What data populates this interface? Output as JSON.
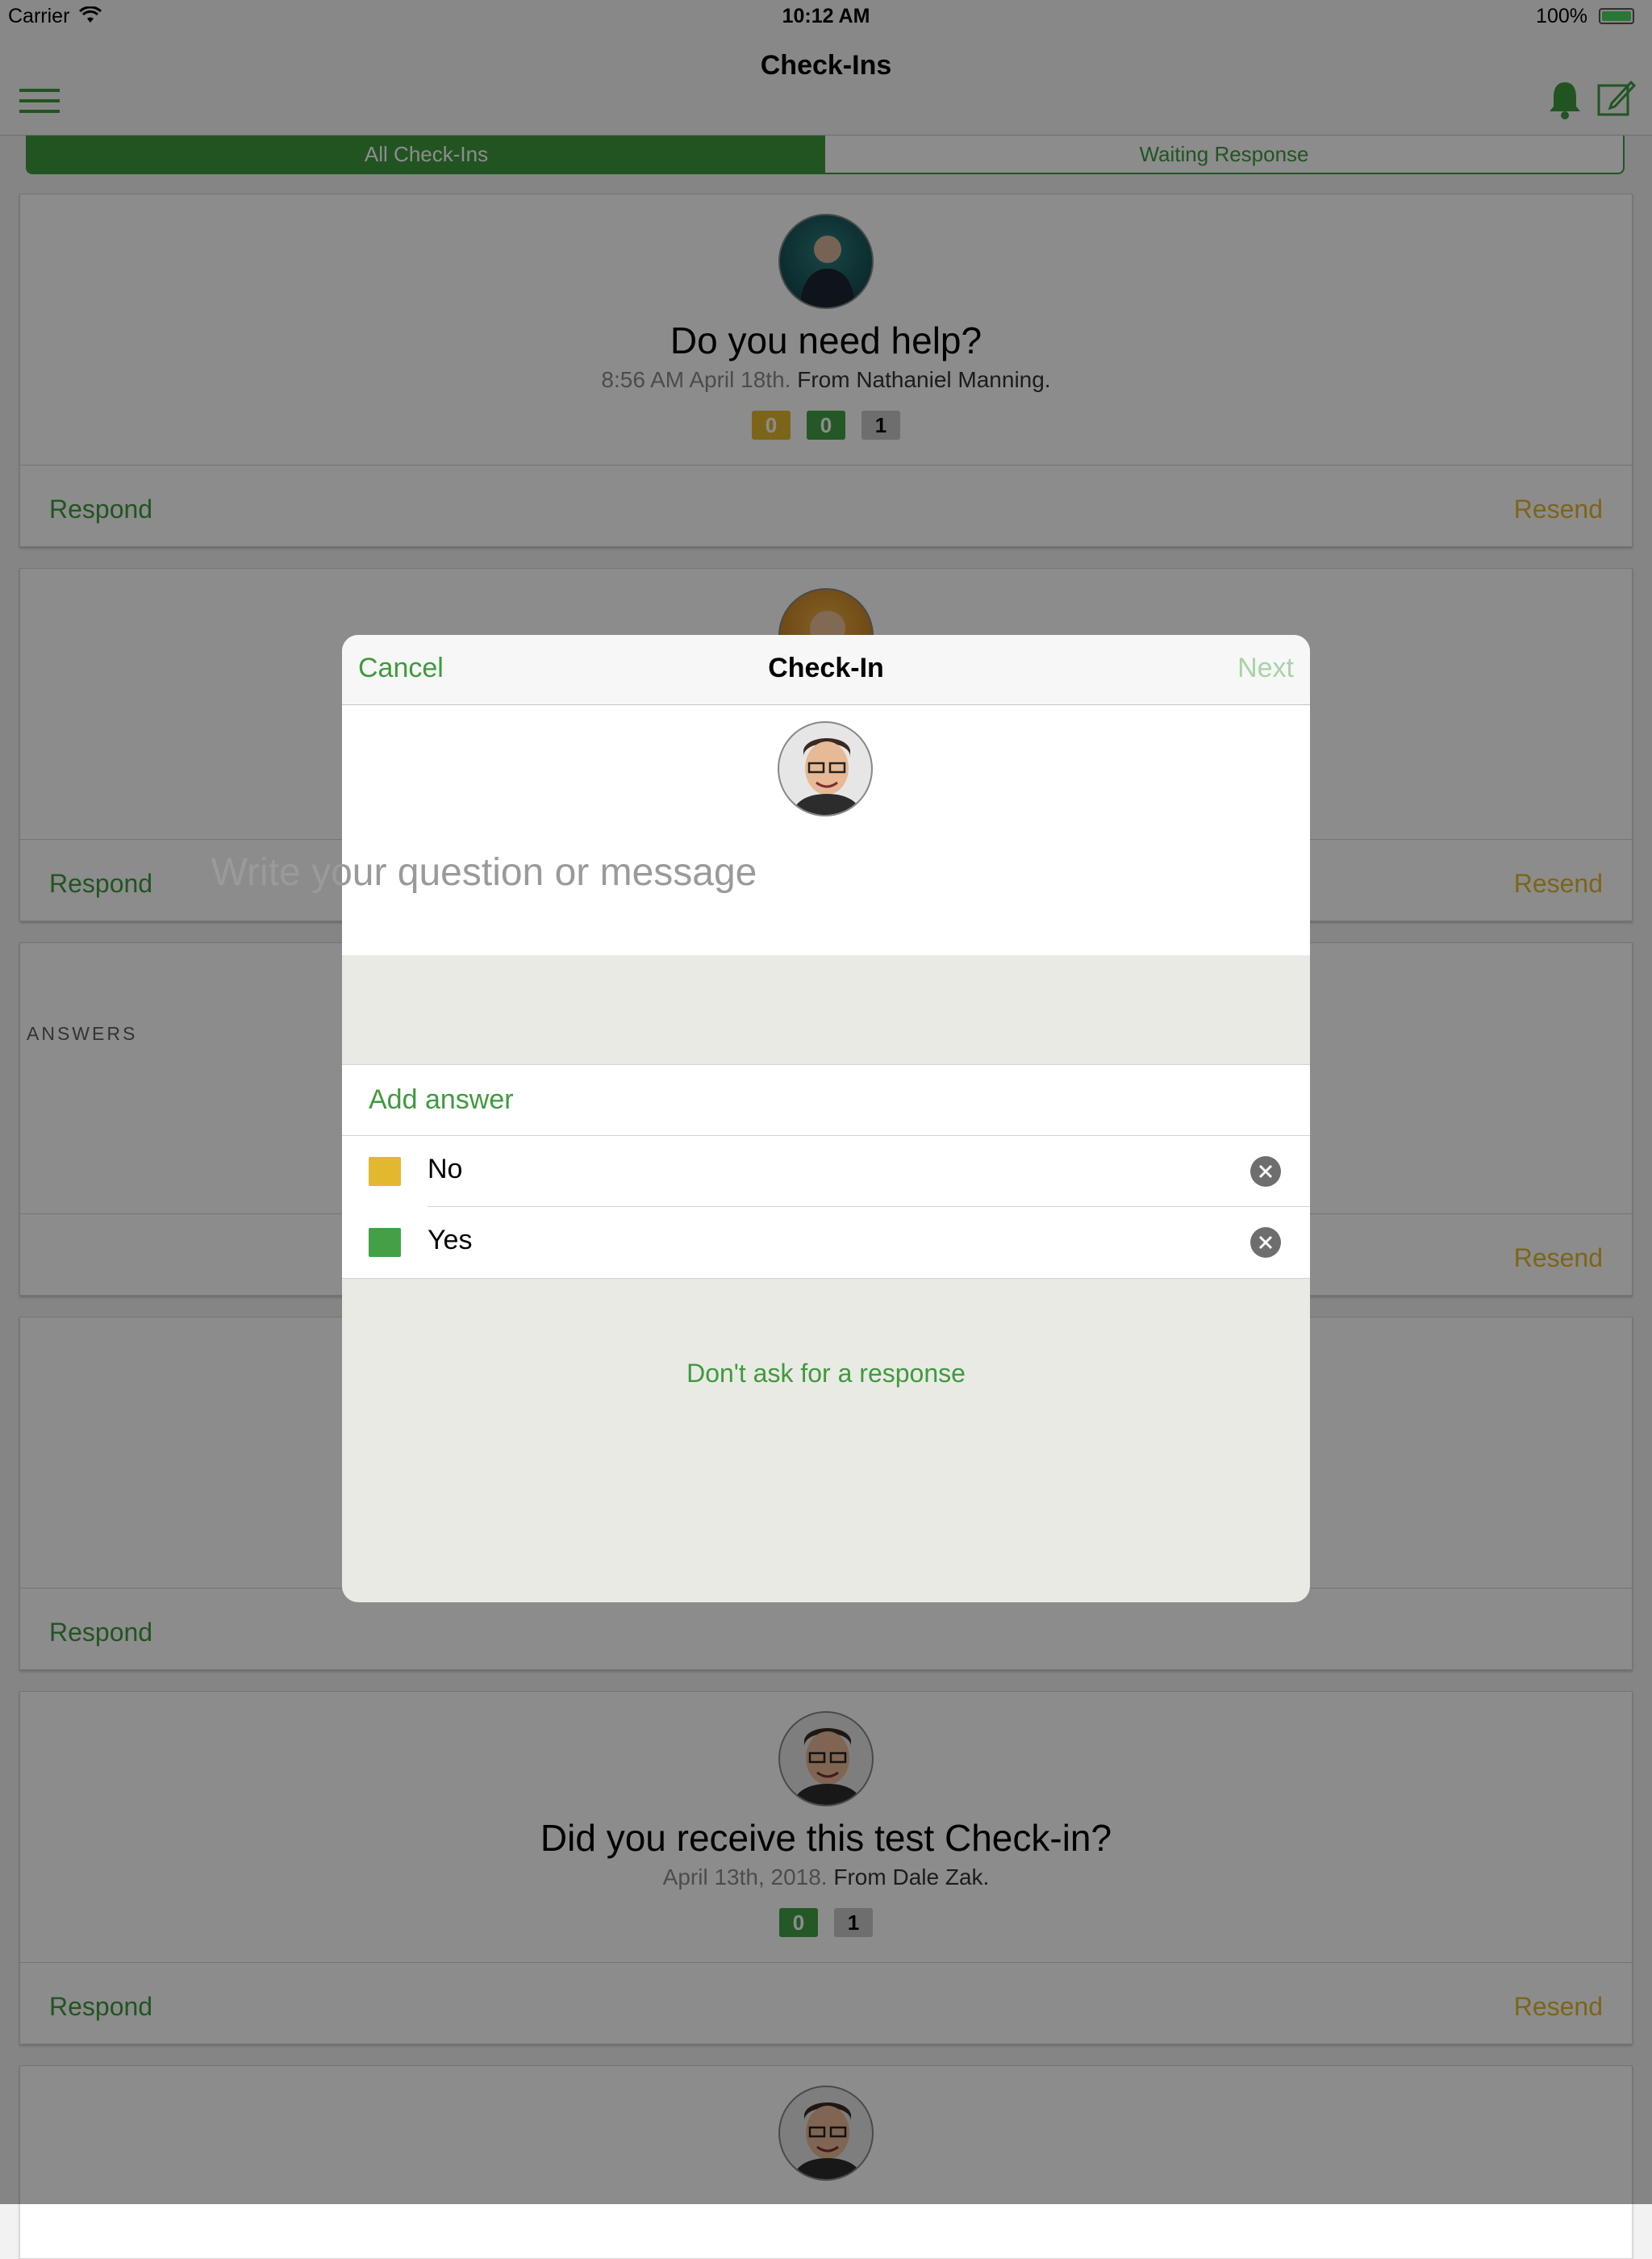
{
  "status_bar": {
    "carrier": "Carrier",
    "time": "10:12 AM",
    "battery": "100%"
  },
  "nav": {
    "title": "Check-Ins",
    "icons": [
      "menu-icon",
      "bell-icon",
      "compose-icon"
    ]
  },
  "tabs": [
    {
      "label": "All Check-Ins",
      "active": true
    },
    {
      "label": "Waiting Response",
      "active": false
    }
  ],
  "cards": [
    {
      "title": "Do you need help?",
      "time": "8:56 AM April 18th.",
      "from": "From Nathaniel Manning.",
      "badges": [
        "0",
        "0",
        "1"
      ],
      "respond": "Respond",
      "resend": "Resend"
    },
    {
      "respond": "Respond",
      "resend": "Resend"
    },
    {
      "resend": "Resend"
    },
    {
      "respond": "Respond"
    },
    {
      "title": "Did you receive this test Check-in?",
      "time": "April 13th, 2018.",
      "from": "From Dale Zak.",
      "badges": [
        "0",
        "1"
      ],
      "respond": "Respond",
      "resend": "Resend"
    }
  ],
  "modal": {
    "cancel": "Cancel",
    "title": "Check-In",
    "next": "Next",
    "placeholder": "Write your question or message",
    "section": "ANSWERS",
    "add_answer": "Add answer",
    "answers": [
      {
        "label": "No",
        "color": "#E2B82F"
      },
      {
        "label": "Yes",
        "color": "#43A047"
      }
    ],
    "dont_ask": "Don't ask for a response"
  },
  "colors": {
    "accent": "#3F9A3F",
    "resend": "#E2B82F"
  }
}
